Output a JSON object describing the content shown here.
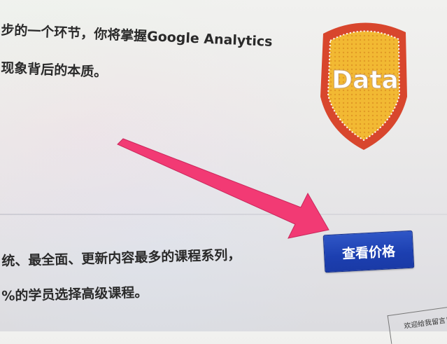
{
  "content": {
    "line1": "步的一个环节，你将掌握Google Analytics",
    "line2": "现象背后的本质。",
    "line3": "统、最全面、更新内容最多的课程系列，",
    "line4": "%的学员选择高级课程。"
  },
  "badge": {
    "label": "Data",
    "colors": {
      "shield": "#d8462d",
      "fill": "#f2b933",
      "text": "#ffffff"
    }
  },
  "cta": {
    "label": "查看价格",
    "color": "#1f44b8"
  },
  "annotation": {
    "arrow_color": "#f23a74",
    "icon": "arrow-icon"
  },
  "footer": {
    "corner_text": "欢迎给我留言！"
  }
}
